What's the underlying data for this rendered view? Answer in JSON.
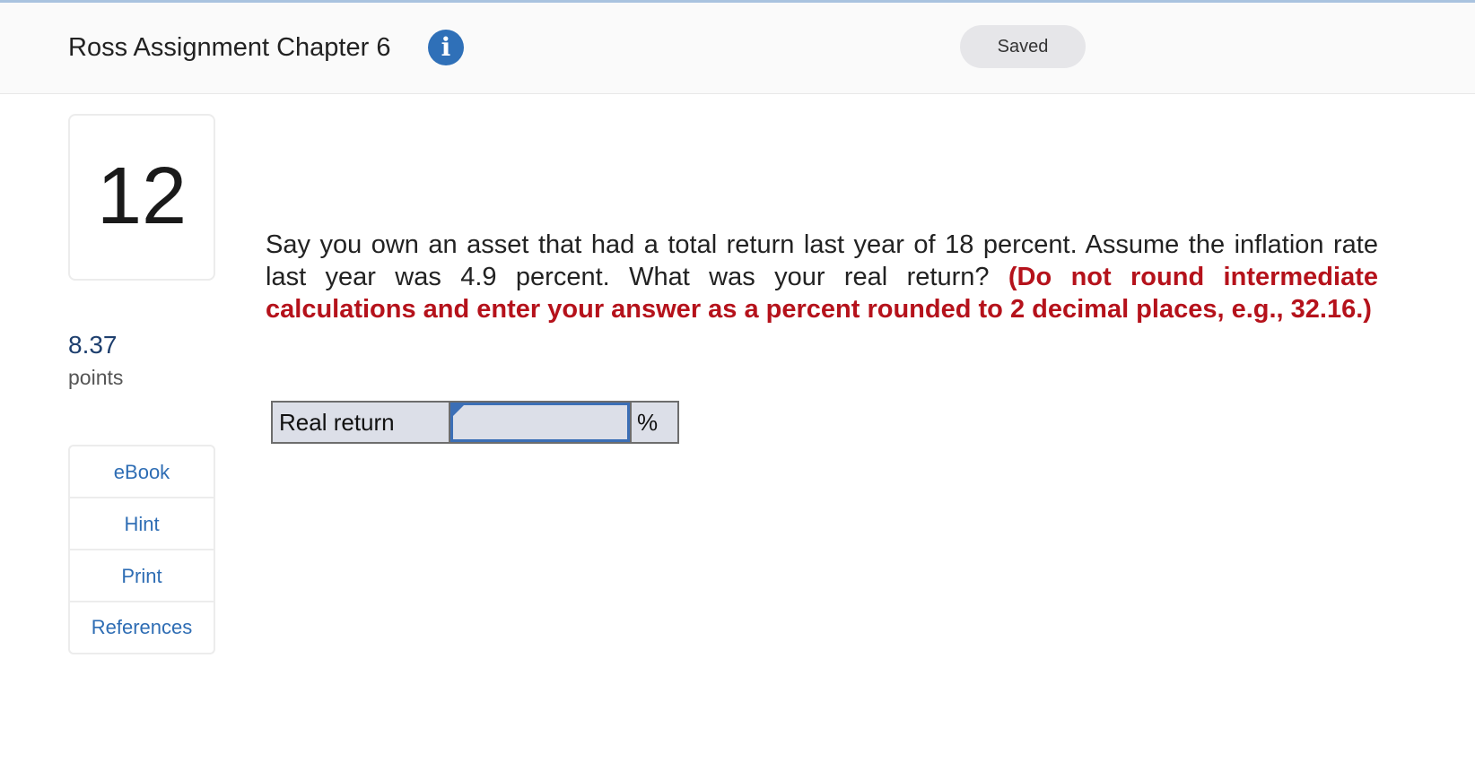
{
  "header": {
    "title": "Ross Assignment Chapter 6",
    "info_icon": "info-icon",
    "saved_label": "Saved"
  },
  "question": {
    "number": "12",
    "points_value": "8.37",
    "points_label": "points",
    "text": "Say you own an asset that had a total return last year of 18 percent. Assume the inflation rate last year was 4.9 percent. What was your real return?",
    "instruction": "(Do not round intermediate calculations and enter your answer as a percent rounded to 2 decimal places, e.g., 32.16.)"
  },
  "tools": [
    {
      "label": "eBook"
    },
    {
      "label": "Hint"
    },
    {
      "label": "Print"
    },
    {
      "label": "References"
    }
  ],
  "answer": {
    "label": "Real return",
    "value": "",
    "unit": "%"
  },
  "colors": {
    "accent": "#2f70b8",
    "instruction_red": "#b5121b",
    "link_blue": "#2e6db4",
    "points_blue": "#1e3f6e",
    "input_bg": "#dcdfe8"
  }
}
